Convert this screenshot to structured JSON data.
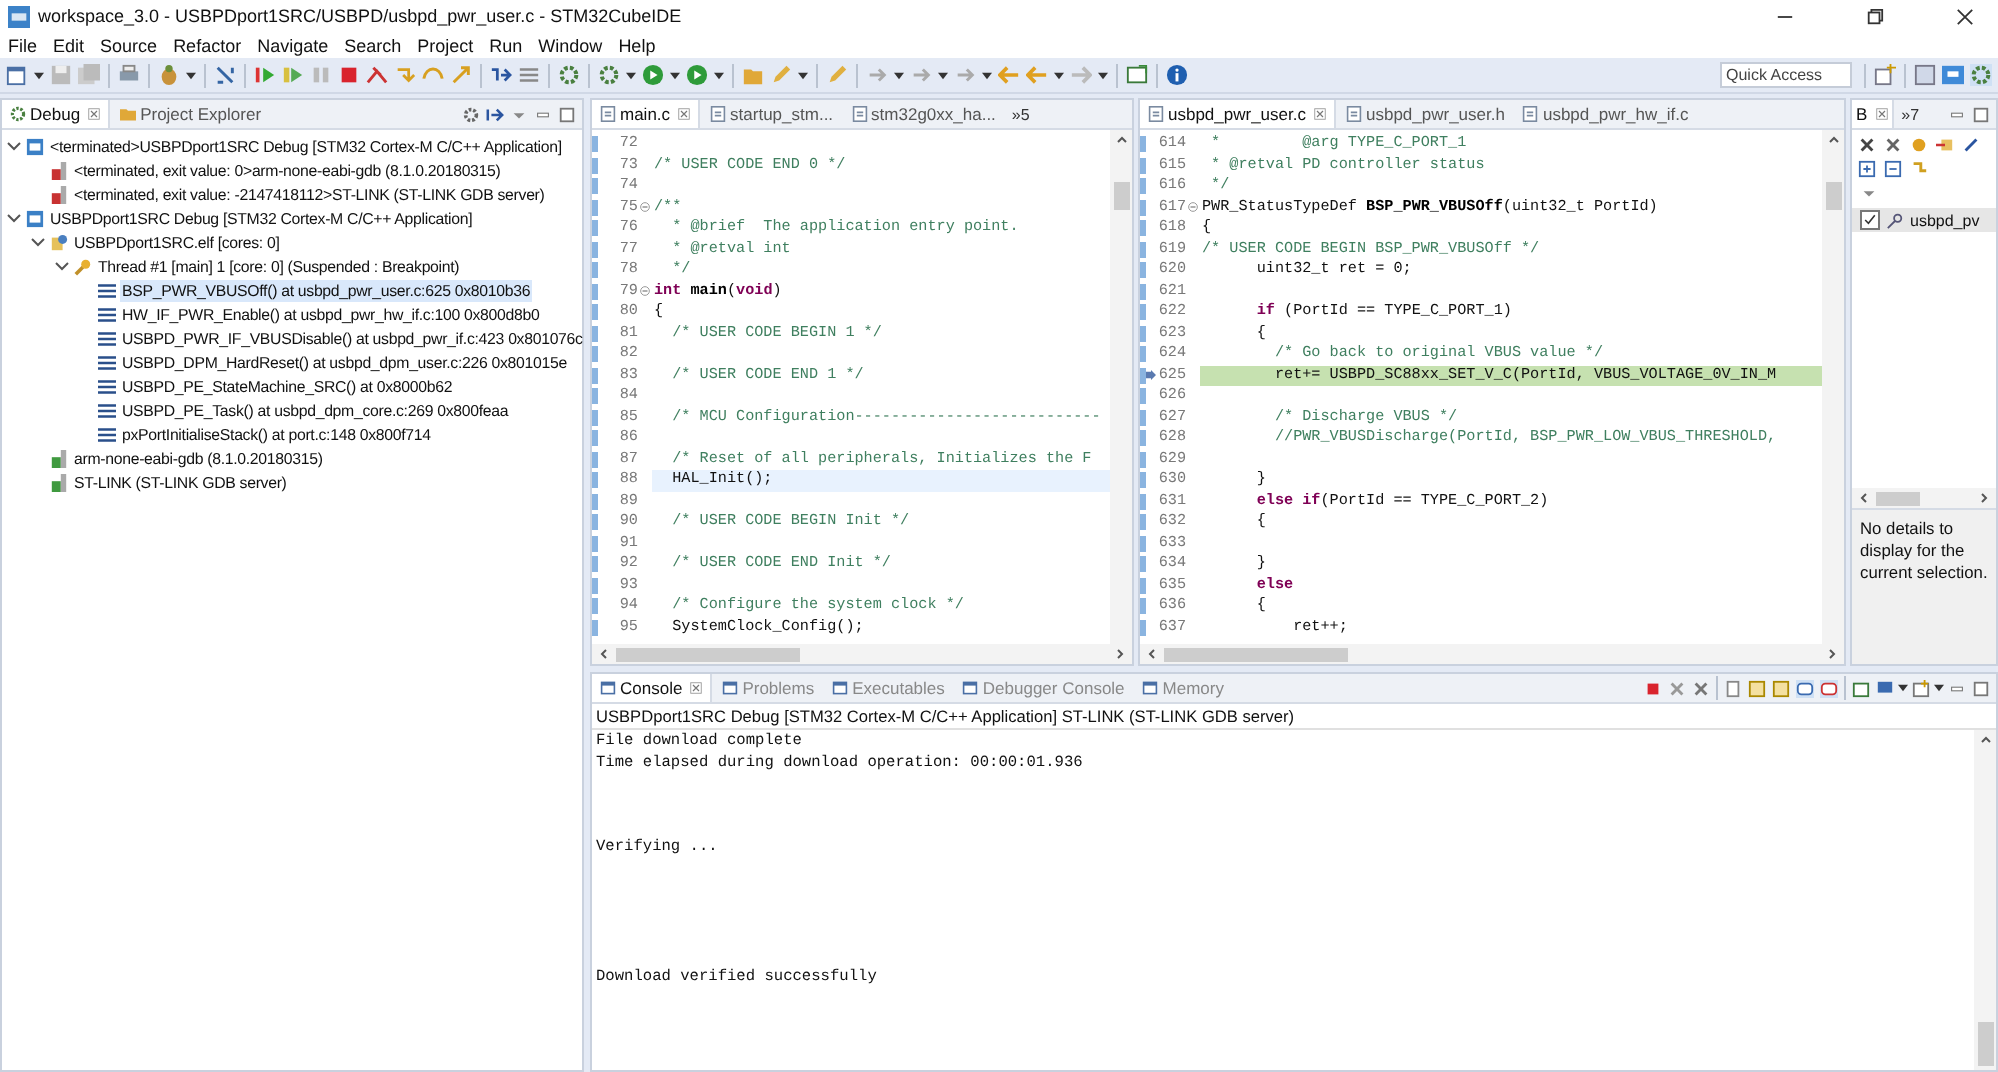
{
  "window": {
    "title": "workspace_3.0 - USBPDport1SRC/USBPD/usbpd_pwr_user.c - STM32CubeIDE"
  },
  "menu": [
    "File",
    "Edit",
    "Source",
    "Refactor",
    "Navigate",
    "Search",
    "Project",
    "Run",
    "Window",
    "Help"
  ],
  "quick_access": {
    "placeholder": "Quick Access"
  },
  "debug_panel": {
    "tabs": [
      {
        "label": "Debug",
        "selected": true
      },
      {
        "label": "Project Explorer",
        "selected": false
      }
    ],
    "tree": [
      {
        "label": "<terminated>USBPDport1SRC Debug [STM32 Cortex-M C/C++ Application]",
        "kind": "launch",
        "expanded": true,
        "selected": false,
        "children": [
          {
            "label": "<terminated, exit value: 0>arm-none-eabi-gdb (8.1.0.20180315)",
            "kind": "terminated_process",
            "selected": false
          },
          {
            "label": "<terminated, exit value: -2147418112>ST-LINK (ST-LINK GDB server)",
            "kind": "terminated_process",
            "selected": false
          }
        ]
      },
      {
        "label": "USBPDport1SRC Debug [STM32 Cortex-M C/C++ Application]",
        "kind": "launch",
        "expanded": true,
        "selected": false,
        "children": [
          {
            "label": "USBPDport1SRC.elf [cores: 0]",
            "kind": "target",
            "expanded": true,
            "selected": false,
            "children": [
              {
                "label": "Thread #1 [main] 1 [core: 0] (Suspended : Breakpoint)",
                "kind": "thread",
                "expanded": true,
                "selected": false,
                "children": [
                  {
                    "label": "BSP_PWR_VBUSOff() at usbpd_pwr_user.c:625 0x8010b36",
                    "kind": "frame",
                    "selected": true
                  },
                  {
                    "label": "HW_IF_PWR_Enable() at usbpd_pwr_hw_if.c:100 0x800d8b0",
                    "kind": "frame",
                    "selected": false
                  },
                  {
                    "label": "USBPD_PWR_IF_VBUSDisable() at usbpd_pwr_if.c:423 0x801076c",
                    "kind": "frame",
                    "selected": false
                  },
                  {
                    "label": "USBPD_DPM_HardReset() at usbpd_dpm_user.c:226 0x801015e",
                    "kind": "frame",
                    "selected": false
                  },
                  {
                    "label": "USBPD_PE_StateMachine_SRC() at 0x8000b62",
                    "kind": "frame",
                    "selected": false
                  },
                  {
                    "label": "USBPD_PE_Task() at usbpd_dpm_core.c:269 0x800feaa",
                    "kind": "frame",
                    "selected": false
                  },
                  {
                    "label": "pxPortInitialiseStack() at port.c:148 0x800f714",
                    "kind": "frame",
                    "selected": false
                  }
                ]
              }
            ]
          },
          {
            "label": "arm-none-eabi-gdb (8.1.0.20180315)",
            "kind": "process",
            "selected": false
          },
          {
            "label": "ST-LINK (ST-LINK GDB server)",
            "kind": "process",
            "selected": false
          }
        ]
      }
    ]
  },
  "editors": [
    {
      "tabs": [
        {
          "label": "main.c",
          "selected": true
        },
        {
          "label": "startup_stm...",
          "selected": false
        },
        {
          "label": "stm32g0xx_ha...",
          "selected": false
        }
      ],
      "overflow": "»5",
      "lines": [
        {
          "number": "72",
          "kind": "code"
        },
        {
          "number": "73",
          "kind": "code",
          "segments": [
            {
              "kind": "comment",
              "text": "/* USER CODE END 0 */"
            }
          ]
        },
        {
          "number": "74",
          "kind": "code"
        },
        {
          "number": "75",
          "foldable": true,
          "kind": "code",
          "segments": [
            {
              "kind": "comment",
              "text": "/**"
            }
          ]
        },
        {
          "number": "76",
          "kind": "code",
          "segments": [
            {
              "kind": "comment",
              "text": "  * @brief  The application entry point."
            }
          ]
        },
        {
          "number": "77",
          "kind": "code",
          "segments": [
            {
              "kind": "comment",
              "text": "  * @retval int"
            }
          ]
        },
        {
          "number": "78",
          "kind": "code",
          "segments": [
            {
              "kind": "comment",
              "text": "  */"
            }
          ]
        },
        {
          "number": "79",
          "foldable": true,
          "kind": "code",
          "segments": [
            {
              "kind": "keyword",
              "text": "int"
            },
            {
              "kind": "bold",
              "text": " main"
            },
            {
              "kind": "plain",
              "text": "("
            },
            {
              "kind": "keyword",
              "text": "void"
            },
            {
              "kind": "plain",
              "text": ")"
            }
          ]
        },
        {
          "number": "80",
          "kind": "code",
          "segments": [
            {
              "kind": "plain",
              "text": "{"
            }
          ]
        },
        {
          "number": "81",
          "kind": "code",
          "segments": [
            {
              "kind": "comment",
              "text": "  /* USER CODE BEGIN 1 */"
            }
          ]
        },
        {
          "number": "82",
          "kind": "code"
        },
        {
          "number": "83",
          "kind": "code",
          "segments": [
            {
              "kind": "comment",
              "text": "  /* USER CODE END 1 */"
            }
          ]
        },
        {
          "number": "84",
          "kind": "code"
        },
        {
          "number": "85",
          "kind": "code",
          "segments": [
            {
              "kind": "comment",
              "text": "  /* MCU Configuration---------------------------"
            }
          ]
        },
        {
          "number": "86",
          "kind": "code"
        },
        {
          "number": "87",
          "kind": "code",
          "segments": [
            {
              "kind": "comment",
              "text": "  /* Reset of all peripherals, Initializes the F"
            }
          ]
        },
        {
          "number": "88",
          "kind": "cursor_line",
          "segments": [
            {
              "kind": "plain",
              "text": "  HAL_Init();"
            }
          ]
        },
        {
          "number": "89",
          "kind": "code"
        },
        {
          "number": "90",
          "kind": "code",
          "segments": [
            {
              "kind": "comment",
              "text": "  /* USER CODE BEGIN Init */"
            }
          ]
        },
        {
          "number": "91",
          "kind": "code"
        },
        {
          "number": "92",
          "kind": "code",
          "segments": [
            {
              "kind": "comment",
              "text": "  /* USER CODE END Init */"
            }
          ]
        },
        {
          "number": "93",
          "kind": "code"
        },
        {
          "number": "94",
          "kind": "code",
          "segments": [
            {
              "kind": "comment",
              "text": "  /* Configure the system clock */"
            }
          ]
        },
        {
          "number": "95",
          "kind": "code",
          "segments": [
            {
              "kind": "plain",
              "text": "  SystemClock_Config();"
            }
          ]
        }
      ]
    },
    {
      "tabs": [
        {
          "label": "usbpd_pwr_user.c",
          "selected": true
        },
        {
          "label": "usbpd_pwr_user.h",
          "selected": false
        },
        {
          "label": "usbpd_pwr_hw_if.c",
          "selected": false
        }
      ],
      "lines": [
        {
          "number": "614",
          "kind": "code",
          "segments": [
            {
              "kind": "comment",
              "text": " *         @arg TYPE_C_PORT_1"
            }
          ]
        },
        {
          "number": "615",
          "kind": "code",
          "segments": [
            {
              "kind": "comment",
              "text": " * @retval PD controller status"
            }
          ]
        },
        {
          "number": "616",
          "kind": "code",
          "segments": [
            {
              "kind": "comment",
              "text": " */"
            }
          ]
        },
        {
          "number": "617",
          "foldable": true,
          "kind": "code",
          "segments": [
            {
              "kind": "plain",
              "text": "PWR_StatusTypeDef "
            },
            {
              "kind": "bold",
              "text": "BSP_PWR_VBUSOff"
            },
            {
              "kind": "plain",
              "text": "(uint32_t PortId)"
            }
          ]
        },
        {
          "number": "618",
          "kind": "code",
          "segments": [
            {
              "kind": "plain",
              "text": "{"
            }
          ]
        },
        {
          "number": "619",
          "kind": "code",
          "segments": [
            {
              "kind": "comment",
              "text": "/* USER CODE BEGIN BSP_PWR_VBUSOff */"
            }
          ]
        },
        {
          "number": "620",
          "kind": "code",
          "segments": [
            {
              "kind": "plain",
              "text": "      uint32_t ret = 0;"
            }
          ]
        },
        {
          "number": "621",
          "kind": "code"
        },
        {
          "number": "622",
          "kind": "code",
          "segments": [
            {
              "kind": "keyword",
              "text": "      if"
            },
            {
              "kind": "plain",
              "text": " (PortId == TYPE_C_PORT_1)"
            }
          ]
        },
        {
          "number": "623",
          "kind": "code",
          "segments": [
            {
              "kind": "plain",
              "text": "      {"
            }
          ]
        },
        {
          "number": "624",
          "kind": "code",
          "segments": [
            {
              "kind": "comment",
              "text": "        /* Go back to original VBUS value */"
            }
          ]
        },
        {
          "number": "625",
          "kind": "instruction_pointer_line",
          "segments": [
            {
              "kind": "plain",
              "text": "        ret+= USBPD_SC88xx_SET_V_C(PortId, VBUS_VOLTAGE_0V_IN_M"
            }
          ]
        },
        {
          "number": "626",
          "kind": "code"
        },
        {
          "number": "627",
          "kind": "code",
          "segments": [
            {
              "kind": "comment",
              "text": "        /* Discharge VBUS */"
            }
          ]
        },
        {
          "number": "628",
          "kind": "code",
          "segments": [
            {
              "kind": "comment",
              "text": "        //PWR_VBUSDischarge(PortId, BSP_PWR_LOW_VBUS_THRESHOLD,"
            }
          ]
        },
        {
          "number": "629",
          "kind": "code"
        },
        {
          "number": "630",
          "kind": "code",
          "segments": [
            {
              "kind": "plain",
              "text": "      }"
            }
          ]
        },
        {
          "number": "631",
          "kind": "code",
          "segments": [
            {
              "kind": "keyword",
              "text": "      else if"
            },
            {
              "kind": "plain",
              "text": "(PortId == TYPE_C_PORT_2)"
            }
          ]
        },
        {
          "number": "632",
          "kind": "code",
          "segments": [
            {
              "kind": "plain",
              "text": "      {"
            }
          ]
        },
        {
          "number": "633",
          "kind": "code"
        },
        {
          "number": "634",
          "kind": "code",
          "segments": [
            {
              "kind": "plain",
              "text": "      }"
            }
          ]
        },
        {
          "number": "635",
          "kind": "code",
          "segments": [
            {
              "kind": "keyword",
              "text": "      else"
            }
          ]
        },
        {
          "number": "636",
          "kind": "code",
          "segments": [
            {
              "kind": "plain",
              "text": "      {"
            }
          ]
        },
        {
          "number": "637",
          "kind": "code",
          "segments": [
            {
              "kind": "plain",
              "text": "          ret++;"
            }
          ]
        }
      ]
    }
  ],
  "outline_panel": {
    "tabs": [
      {
        "label": "B",
        "selected": true
      }
    ],
    "overflow": "»7",
    "items": [
      {
        "label": "usbpd_pv",
        "checked": true
      }
    ],
    "details": "No details to display for the current selection."
  },
  "console": {
    "tabs": [
      {
        "label": "Console",
        "selected": true
      },
      {
        "label": "Problems",
        "selected": false
      },
      {
        "label": "Executables",
        "selected": false
      },
      {
        "label": "Debugger Console",
        "selected": false
      },
      {
        "label": "Memory",
        "selected": false
      }
    ],
    "header": "USBPDport1SRC Debug [STM32 Cortex-M C/C++ Application] ST-LINK (ST-LINK GDB server)",
    "lines": [
      {
        "kind": "text",
        "text": "File download complete"
      },
      {
        "kind": "text",
        "text": "Time elapsed during download operation: 00:00:01.936"
      },
      {
        "kind": "blank"
      },
      {
        "kind": "blank"
      },
      {
        "kind": "blank"
      },
      {
        "kind": "text",
        "text": "Verifying ..."
      },
      {
        "kind": "blank"
      },
      {
        "kind": "blank"
      },
      {
        "kind": "blank"
      },
      {
        "kind": "blank"
      },
      {
        "kind": "blank"
      },
      {
        "kind": "text",
        "text": "Download verified successfully"
      }
    ]
  }
}
